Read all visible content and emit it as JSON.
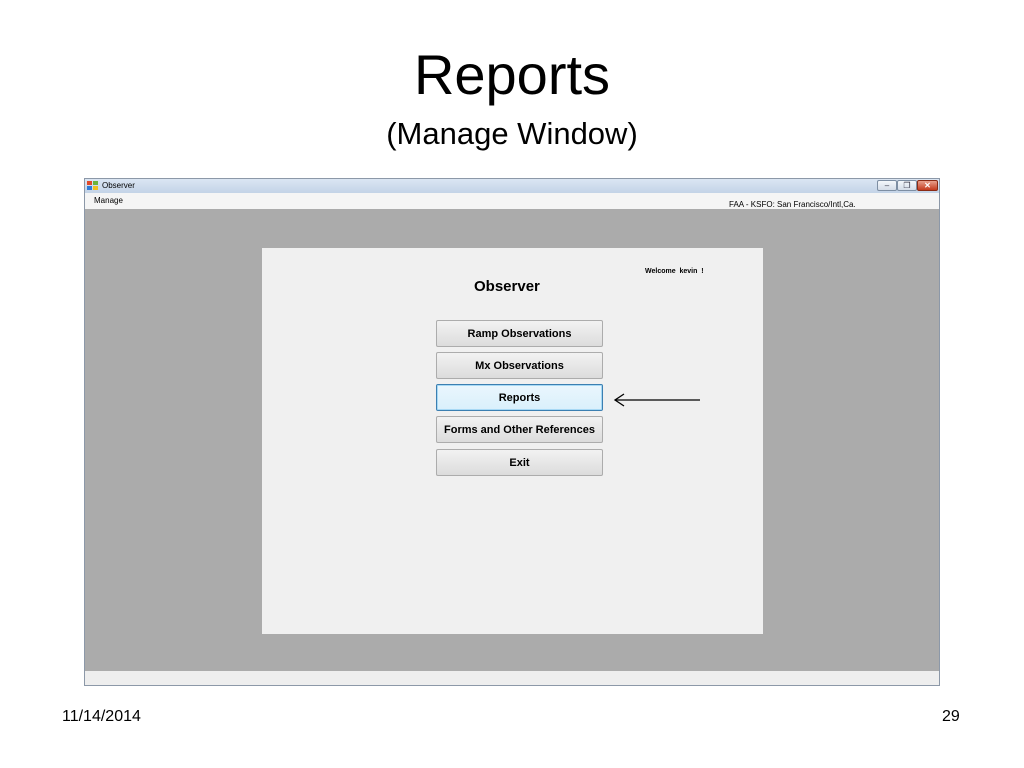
{
  "slide": {
    "title": "Reports",
    "subtitle": "(Manage Window)",
    "date": "11/14/2014",
    "page_number": "29"
  },
  "window": {
    "title": "Observer",
    "icon": "app-icon",
    "controls": {
      "minimize": "minimize-icon",
      "restore": "restore-icon",
      "close": "close-icon",
      "close_color": "#c43a1e"
    }
  },
  "menubar": {
    "items": [
      "Manage"
    ],
    "location": "FAA - KSFO: San Francisco/Intl,Ca."
  },
  "form": {
    "heading": "Observer",
    "welcome": "Welcome  kevin  !",
    "buttons": [
      "Ramp Observations",
      "Mx Observations",
      "Reports",
      "Forms and Other References",
      "Exit"
    ],
    "focused_button": "Reports"
  },
  "annotation": {
    "arrow": "left-arrow-icon",
    "points_to": "Reports"
  },
  "colors": {
    "mdi_background": "#ababab",
    "form_background": "#f0f0f0",
    "focus_border": "#3c7fb1"
  }
}
